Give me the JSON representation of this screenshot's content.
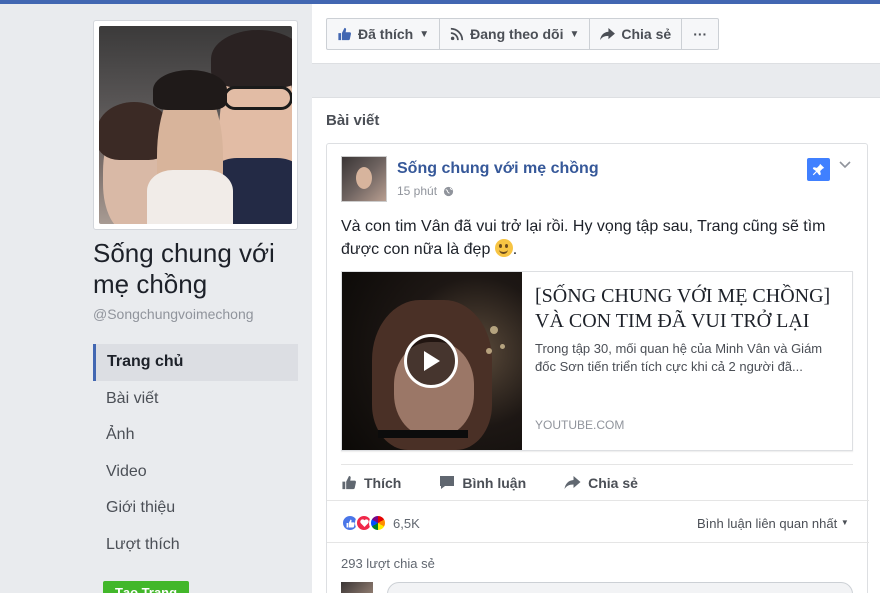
{
  "page": {
    "name": "Sống chung với mẹ chồng",
    "handle": "@Songchungvoimechong"
  },
  "nav": {
    "items": [
      {
        "label": "Trang chủ",
        "active": true
      },
      {
        "label": "Bài viết"
      },
      {
        "label": "Ảnh"
      },
      {
        "label": "Video"
      },
      {
        "label": "Giới thiệu"
      },
      {
        "label": "Lượt thích"
      }
    ],
    "create_page_label": "Tạo Trang"
  },
  "actions": {
    "liked_label": "Đã thích",
    "following_label": "Đang theo dõi",
    "share_label": "Chia sẻ",
    "more_label": "···"
  },
  "posts": {
    "section_title": "Bài viết",
    "post": {
      "author": "Sống chung với mẹ chồng",
      "time": "15 phút",
      "text": "Và con tim Vân đã vui trở lại rồi. Hy vọng tập sau, Trang cũng sẽ tìm được con nữa là đẹp",
      "link": {
        "title": "[SỐNG CHUNG VỚI MẸ CHỒNG] VÀ CON TIM ĐÃ VUI TRỞ LẠI",
        "description": "Trong tập 30, mối quan hệ của Minh Vân và Giám đốc Sơn tiến triển tích cực khi cả 2 người đã...",
        "source": "YOUTUBE.COM"
      },
      "actions": {
        "like_label": "Thích",
        "comment_label": "Bình luận",
        "share_label": "Chia sẻ"
      },
      "reaction_count": "6,5K",
      "sort_label": "Bình luận liên quan nhất",
      "shares": "293 lượt chia sẻ"
    }
  },
  "colors": {
    "brand": "#4267b2",
    "link": "#365899",
    "pin": "#4080ff",
    "create_button": "#42b72a"
  },
  "icons": [
    "thumbs-up-icon",
    "rss-icon",
    "share-arrow-icon",
    "more-icon",
    "globe-icon",
    "pin-icon",
    "play-icon",
    "comment-icon",
    "like-reaction-icon",
    "love-reaction-icon",
    "pride-reaction-icon"
  ]
}
